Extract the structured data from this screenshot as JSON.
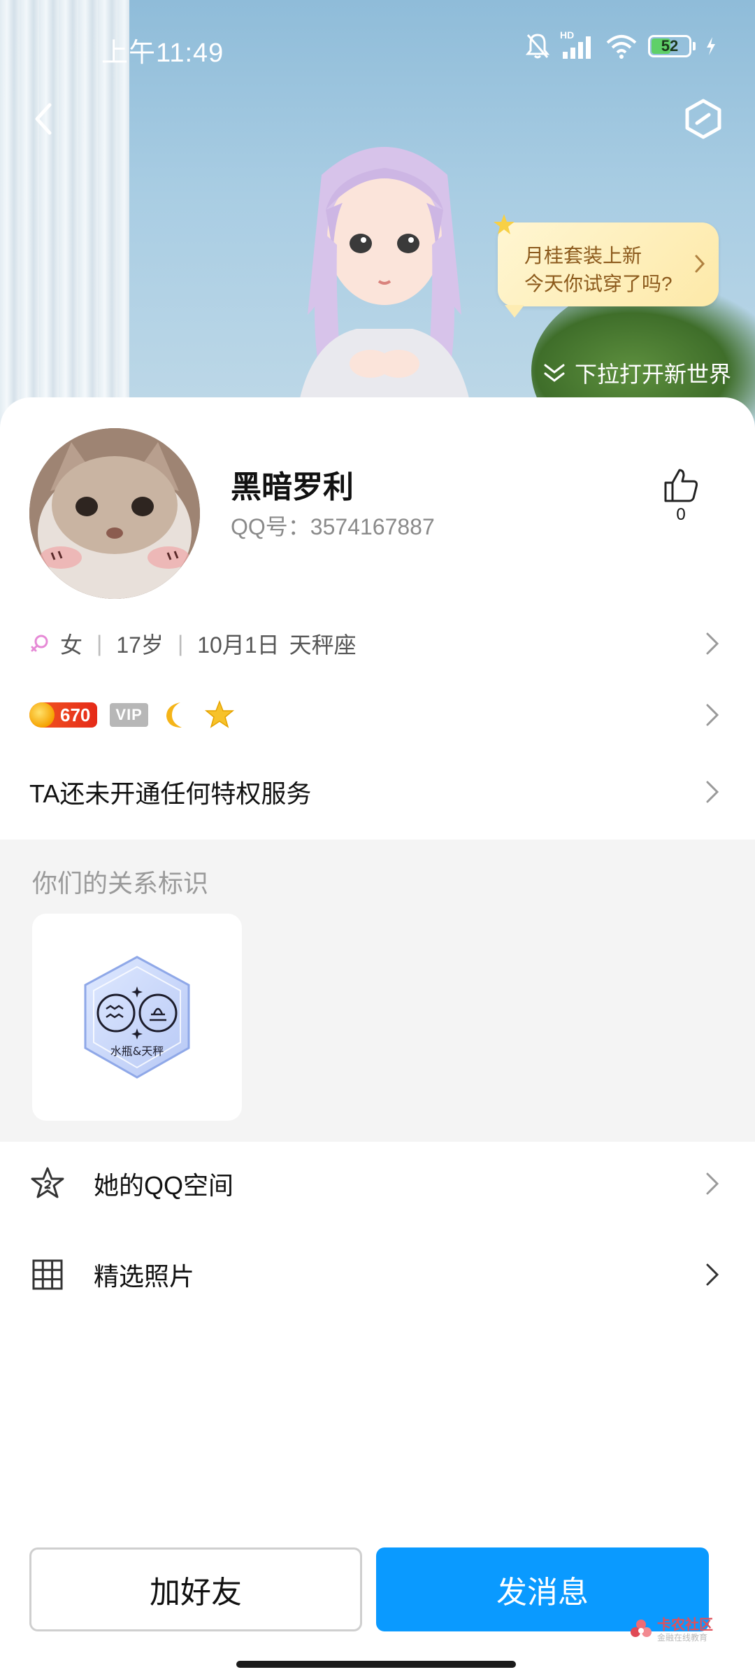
{
  "status_bar": {
    "time": "上午11:49",
    "network_label": "HD",
    "battery_level": "52",
    "battery_percent": 0.52
  },
  "hero": {
    "bubble_line1": "月桂套装上新",
    "bubble_line2": "今天你试穿了吗?",
    "pull_hint": "下拉打开新世界"
  },
  "profile": {
    "nickname": "黑暗罗利",
    "qq_number": "QQ号：3574167887",
    "like_count": "0",
    "gender": "女",
    "age": "17岁",
    "birthday": "10月1日",
    "constellation": "天秤座",
    "level": "670",
    "vip_label": "VIP",
    "privilege_text": "TA还未开通任何特权服务"
  },
  "relation": {
    "title": "你们的关系标识",
    "badge_label": "水瓶&天秤"
  },
  "menu": {
    "qzone_label": "她的QQ空间",
    "photos_label": "精选照片"
  },
  "actions": {
    "add_friend": "加好友",
    "send_message": "发消息"
  },
  "watermark": {
    "title": "卡农社区",
    "subtitle": "金融在线教育"
  },
  "colors": {
    "primary_button": "#0a9aff",
    "level_badge": "#e52a18",
    "gender_icon": "#e68ad6"
  }
}
